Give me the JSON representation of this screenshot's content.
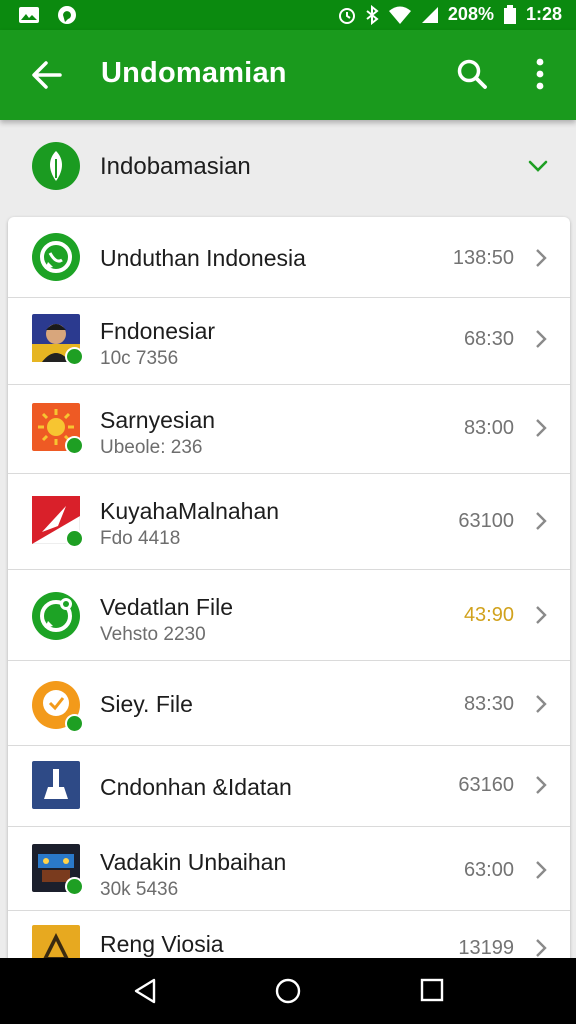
{
  "status_bar": {
    "battery": "208%",
    "time": "1:28"
  },
  "app_bar": {
    "title": "Undomamian"
  },
  "header": {
    "label": "Indobamasian"
  },
  "list": [
    {
      "name": "Unduthan Indonesia",
      "sub": "",
      "time": "138:50",
      "icon": "whatsapp-icon"
    },
    {
      "name": "Fndonesiar",
      "sub": "10c 7356",
      "time": "68:30",
      "icon": "avatar-icon"
    },
    {
      "name": "Sarnyesian",
      "sub": "Ubeole: 236",
      "time": "83:00",
      "icon": "sun-icon"
    },
    {
      "name": "KuyahaMalnahan",
      "sub": "Fdo 4418",
      "time": "63100",
      "icon": "red-arrow-icon"
    },
    {
      "name": "Vedatlan File",
      "sub": "Vehsto 2230",
      "time": "43:90",
      "icon": "whatsapp-icon"
    },
    {
      "name": "Siey. File",
      "sub": "",
      "time": "83:30",
      "icon": "orange-circle-icon"
    },
    {
      "name": "Cndonhan &Idatan",
      "sub": "",
      "time": "63160",
      "icon": "cleaner-icon"
    },
    {
      "name": "Vadakin Unbaihan",
      "sub": "30k 5436",
      "time": "63:00",
      "icon": "game-icon"
    },
    {
      "name": "Reng Viosia",
      "sub": "",
      "time": "13199",
      "icon": "yellow-triangle-icon"
    }
  ],
  "colors": {
    "app_bar": "#1a9a1d",
    "status_bar": "#0b8a0f",
    "accent_green": "#1e9f23",
    "highlight_time": "#d1a21d"
  }
}
